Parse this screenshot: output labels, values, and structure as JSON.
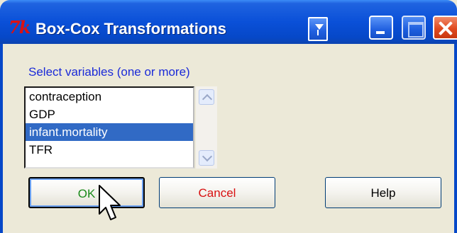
{
  "window": {
    "title": "Box-Cox Transformations",
    "app_icon_text": "7k"
  },
  "variables": {
    "label": "Select variables (one or more)",
    "items": [
      {
        "label": "contraception"
      },
      {
        "label": "GDP"
      },
      {
        "label": "infant.mortality",
        "selected": true
      },
      {
        "label": "TFR"
      }
    ],
    "selected": "infant.mortality"
  },
  "buttons": {
    "ok_label": "OK",
    "cancel_label": "Cancel",
    "help_label": "Help"
  },
  "colors": {
    "title_bar": "#0a50d8",
    "section_label": "#1a2ad8",
    "selection": "#316ac5",
    "ok_text": "#1a8a1a",
    "cancel_text": "#d81010"
  },
  "icons": [
    "tk-app-icon",
    "pin-icon",
    "minimize-icon",
    "maximize-icon",
    "close-icon",
    "scroll-up-icon",
    "scroll-down-icon",
    "mouse-cursor-icon"
  ]
}
